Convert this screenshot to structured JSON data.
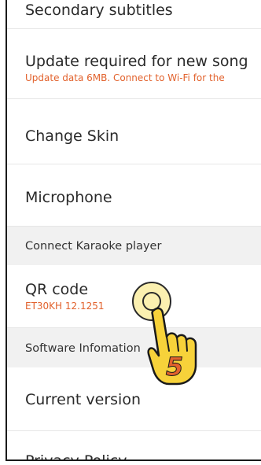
{
  "settings": {
    "items": [
      {
        "title": "Secondary subtitles"
      },
      {
        "title": "Update required for new song",
        "subtitle": "Update data 6MB. Connect to Wi-Fi for the"
      },
      {
        "title": "Change Skin"
      },
      {
        "title": "Microphone"
      },
      {
        "section": "Connect Karaoke player"
      },
      {
        "title": "QR code",
        "subtitle": "ET30KH 12.1251"
      },
      {
        "section": "Software Infomation"
      },
      {
        "title": "Current version"
      },
      {
        "title": "Privacy Policy"
      }
    ]
  },
  "annotation": {
    "step_number": "5",
    "colors": {
      "highlight": "#f6dd50",
      "hand": "#f7d23a",
      "number": "#e2622d"
    },
    "icons": [
      "tap-highlight-icon",
      "pointing-hand-icon"
    ]
  }
}
